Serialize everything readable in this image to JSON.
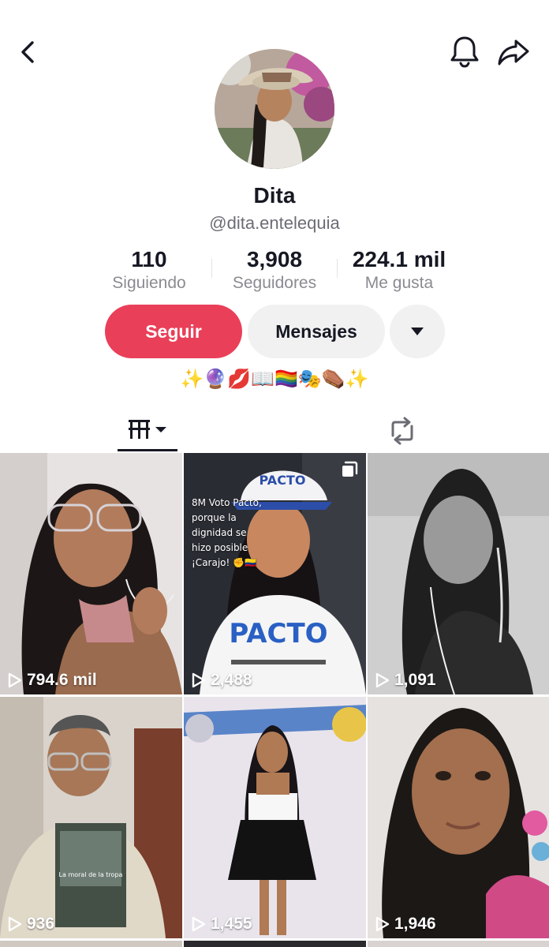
{
  "profile": {
    "name": "Dita",
    "handle": "@dita.entelequia",
    "bio": "✨🔮💋📖🏳️‍🌈🎭⚰️✨"
  },
  "stats": [
    {
      "value": "110",
      "label": "Siguiendo"
    },
    {
      "value": "3,908",
      "label": "Seguidores"
    },
    {
      "value": "224.1 mil",
      "label": "Me gusta"
    }
  ],
  "actions": {
    "follow_label": "Seguir",
    "message_label": "Mensajes"
  },
  "colors": {
    "accent": "#ea3f59",
    "secondary_button": "#f1f1f2",
    "muted_text": "#8a8b91"
  },
  "icons": {
    "back": "chevron-left-icon",
    "notifications": "bell-icon",
    "share": "share-arrow-icon",
    "more": "caret-down-icon",
    "videos_tab": "grid-bars-icon",
    "reposts_tab": "repost-icon",
    "play": "play-outline-icon"
  },
  "videos": [
    {
      "views": "794.6 mil"
    },
    {
      "views": "2,488",
      "overlay_text": "8M Voto Pacto, porque la dignidad se hizo posible ¡Carajo! ✊🇨🇴",
      "multi_image": true
    },
    {
      "views": "1,091"
    },
    {
      "views": "936"
    },
    {
      "views": "1,455"
    },
    {
      "views": "1,946"
    }
  ]
}
